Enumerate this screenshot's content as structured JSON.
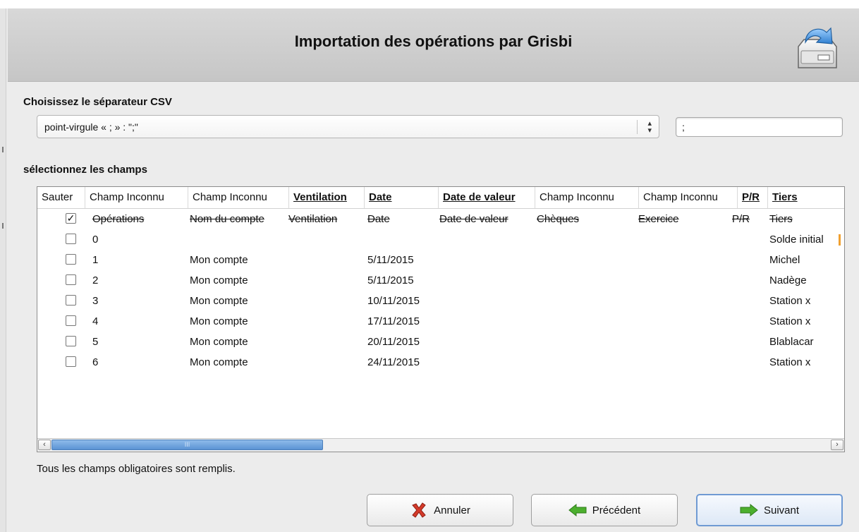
{
  "header": {
    "title": "Importation des opérations par Grisbi"
  },
  "separator": {
    "label": "Choisissez le séparateur CSV",
    "selected": "point-virgule « ; » : \";\"",
    "custom_value": ";"
  },
  "fields": {
    "label": "sélectionnez les champs",
    "columns": [
      {
        "label": "Sauter",
        "bold": false
      },
      {
        "label": "Champ Inconnu",
        "bold": false
      },
      {
        "label": "Champ Inconnu",
        "bold": false
      },
      {
        "label": "Ventilation",
        "bold": true
      },
      {
        "label": "Date",
        "bold": true
      },
      {
        "label": "Date de valeur",
        "bold": true
      },
      {
        "label": "Champ Inconnu",
        "bold": false
      },
      {
        "label": "Champ Inconnu",
        "bold": false
      },
      {
        "label": "P/R",
        "bold": true
      },
      {
        "label": "Tiers",
        "bold": true
      }
    ],
    "rows": [
      {
        "skip": true,
        "cells": [
          "Opérations",
          "Nom du compte",
          "Ventilation",
          "Date",
          "Date de valeur",
          "Chèques",
          "Exercice",
          "P/R",
          "Tiers"
        ]
      },
      {
        "skip": false,
        "cells": [
          "0",
          "",
          "",
          "",
          "",
          "",
          "",
          "",
          "Solde initial"
        ]
      },
      {
        "skip": false,
        "cells": [
          "1",
          "Mon compte",
          "",
          "5/11/2015",
          "",
          "",
          "",
          "",
          "Michel"
        ]
      },
      {
        "skip": false,
        "cells": [
          "2",
          "Mon compte",
          "",
          "5/11/2015",
          "",
          "",
          "",
          "",
          "Nadège"
        ]
      },
      {
        "skip": false,
        "cells": [
          "3",
          "Mon compte",
          "",
          "10/11/2015",
          "",
          "",
          "",
          "",
          "Station x"
        ]
      },
      {
        "skip": false,
        "cells": [
          "4",
          "Mon compte",
          "",
          "17/11/2015",
          "",
          "",
          "",
          "",
          "Station x"
        ]
      },
      {
        "skip": false,
        "cells": [
          "5",
          "Mon compte",
          "",
          "20/11/2015",
          "",
          "",
          "",
          "",
          "Blablacar"
        ]
      },
      {
        "skip": false,
        "cells": [
          "6",
          "Mon compte",
          "",
          "24/11/2015",
          "",
          "",
          "",
          "",
          "Station x"
        ]
      }
    ],
    "scrollbar_grip": "III"
  },
  "status": "Tous les champs obligatoires sont remplis.",
  "buttons": {
    "cancel": "Annuler",
    "previous": "Précédent",
    "next": "Suivant"
  },
  "icons": {
    "header": "import-drive-icon",
    "cancel": "red-x-icon",
    "previous": "green-left-arrow-icon",
    "next": "green-right-arrow-icon"
  },
  "colors": {
    "header_bg": "#cdcdcd",
    "scroll_thumb": "#5b93d4",
    "arrow_green": "#4caf2e",
    "cancel_red": "#d43a2a"
  }
}
